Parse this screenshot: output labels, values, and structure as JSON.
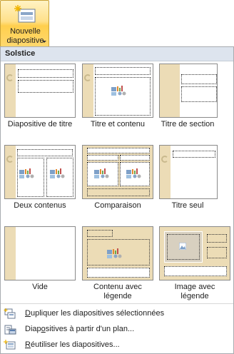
{
  "ribbon_button": {
    "line1": "Nouvelle",
    "line2": "diapositive",
    "icon": "new-slide-icon"
  },
  "gallery": {
    "theme_name": "Solstice",
    "layouts": [
      {
        "label": "Diapositive de titre",
        "kind": "title-slide"
      },
      {
        "label": "Titre et contenu",
        "kind": "title-content"
      },
      {
        "label": "Titre de section",
        "kind": "section-header"
      },
      {
        "label": "Deux contenus",
        "kind": "two-content"
      },
      {
        "label": "Comparaison",
        "kind": "comparison"
      },
      {
        "label": "Titre seul",
        "kind": "title-only"
      },
      {
        "label": "Vide",
        "kind": "blank"
      },
      {
        "label_line1": "Contenu avec",
        "label_line2": "légende",
        "kind": "content-caption"
      },
      {
        "label_line1": "Image avec",
        "label_line2": "légende",
        "kind": "picture-caption"
      }
    ]
  },
  "menu": {
    "items": [
      {
        "accel": "D",
        "rest": "upliquer les diapositives sélectionnées",
        "icon": "duplicate-slides-icon"
      },
      {
        "pre": "Diap",
        "accel": "o",
        "rest": "sitives à partir d'un plan...",
        "icon": "slides-from-outline-icon"
      },
      {
        "accel": "R",
        "rest": "éutiliser les diapositives...",
        "icon": "reuse-slides-icon"
      }
    ]
  },
  "colors": {
    "accent_stripe": "#ecdcb6",
    "header_bg": "#dde4ee",
    "button_highlight": "#ffd86e"
  }
}
